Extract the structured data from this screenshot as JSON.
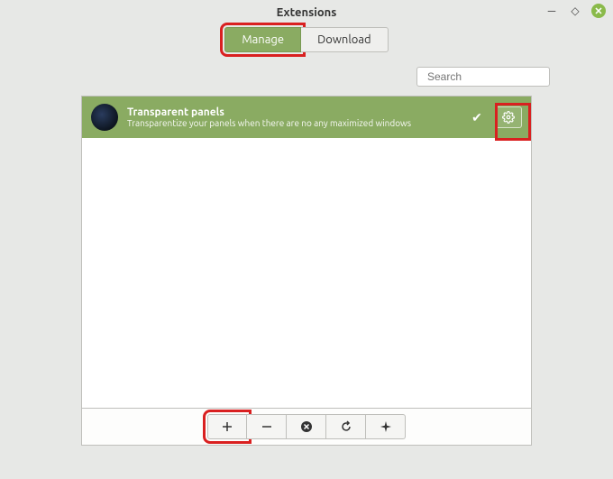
{
  "window": {
    "title": "Extensions"
  },
  "tabs": {
    "manage": "Manage",
    "download": "Download",
    "active": "manage"
  },
  "search": {
    "placeholder": "Search"
  },
  "extension": {
    "title": "Transparent panels",
    "description": "Transparentize your panels when there are no any maximized windows",
    "enabled": true
  },
  "toolbar": {
    "add": "+",
    "remove": "−",
    "delete": "✕",
    "undo": "↺",
    "more": "✦"
  }
}
